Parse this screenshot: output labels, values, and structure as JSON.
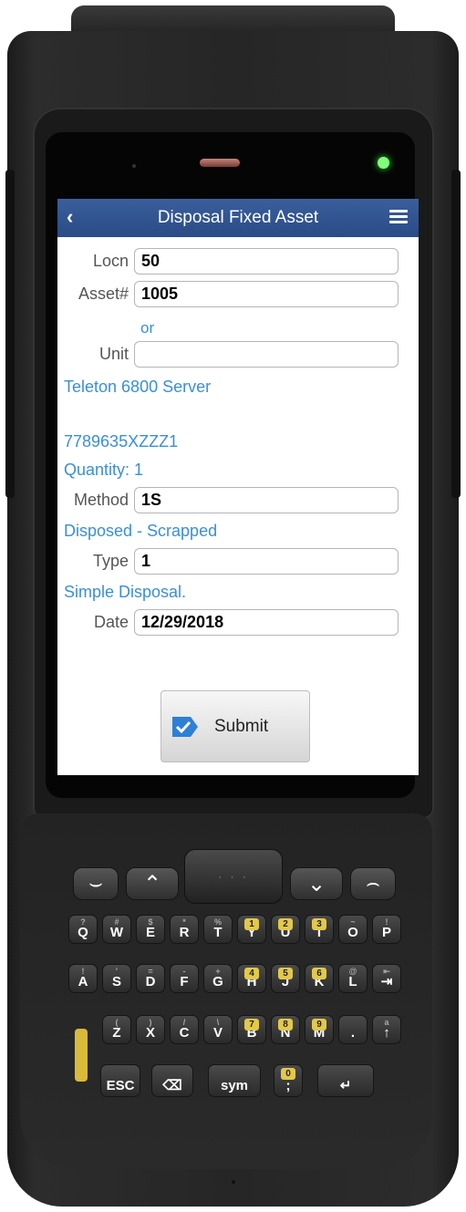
{
  "app": {
    "title": "Disposal Fixed Asset",
    "back_icon": "chevron-left-icon",
    "menu_icon": "hamburger-menu-icon",
    "header_color": "#2f5290"
  },
  "form": {
    "locn": {
      "label": "Locn",
      "value": "50"
    },
    "asset": {
      "label": "Asset#",
      "value": "1005"
    },
    "or_text": "or",
    "unit": {
      "label": "Unit",
      "value": ""
    },
    "asset_description": "Teleton 6800 Server",
    "serial_number": "7789635XZZZ1",
    "quantity_text": "Quantity: 1",
    "method": {
      "label": "Method",
      "value": "1S"
    },
    "method_description": "Disposed - Scrapped",
    "type": {
      "label": "Type",
      "value": "1"
    },
    "type_description": "Simple Disposal.",
    "date": {
      "label": "Date",
      "value": "12/29/2018"
    }
  },
  "submit": {
    "label": "Submit",
    "icon": "checkmark-icon",
    "icon_color": "#2e7fd6"
  },
  "colors": {
    "info_text": "#3a8fd6",
    "accent": "#2f5290"
  },
  "keypad": {
    "row1": [
      {
        "main": "Q",
        "sub": "?"
      },
      {
        "main": "W",
        "sub": "#"
      },
      {
        "main": "E",
        "sub": "$"
      },
      {
        "main": "R",
        "sub": "*"
      },
      {
        "main": "T",
        "sub": "%"
      },
      {
        "main": "Y",
        "num": "1"
      },
      {
        "main": "U",
        "num": "2"
      },
      {
        "main": "I",
        "num": "3"
      },
      {
        "main": "O",
        "sub": "~"
      },
      {
        "main": "P",
        "sub": "!"
      }
    ],
    "row2": [
      {
        "main": "A",
        "sub": "!"
      },
      {
        "main": "S",
        "sub": "'"
      },
      {
        "main": "D",
        "sub": "="
      },
      {
        "main": "F",
        "sub": "-"
      },
      {
        "main": "G",
        "sub": "+"
      },
      {
        "main": "H",
        "num": "4"
      },
      {
        "main": "J",
        "num": "5"
      },
      {
        "main": "K",
        "num": "6"
      },
      {
        "main": "L",
        "sub": "@"
      },
      {
        "main": "⇥",
        "sub": "⇤"
      }
    ],
    "row3": [
      {
        "main": "Z",
        "sub": "("
      },
      {
        "main": "X",
        "sub": ")"
      },
      {
        "main": "C",
        "sub": "/"
      },
      {
        "main": "V",
        "sub": "\\"
      },
      {
        "main": "B",
        "num": "7"
      },
      {
        "main": "N",
        "num": "8"
      },
      {
        "main": "M",
        "num": "9"
      },
      {
        "main": ".",
        "sub": ""
      },
      {
        "main": "↑",
        "sub": "a"
      }
    ],
    "row4": {
      "esc": "ESC",
      "sym": "sym",
      "zero": "0",
      "comma": ";"
    }
  }
}
